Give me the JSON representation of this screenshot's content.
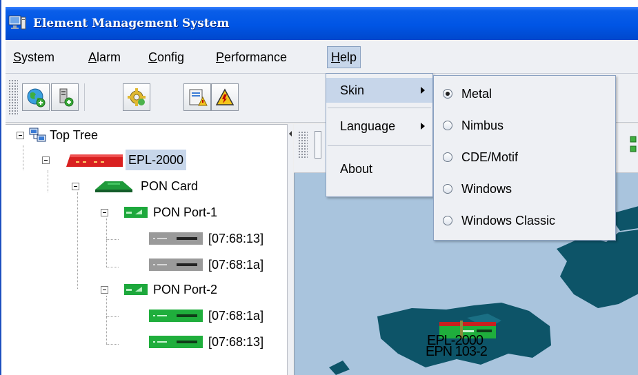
{
  "window": {
    "title": "Element Management System",
    "title_icon": "monitor-app-icon"
  },
  "menubar": {
    "items": [
      {
        "id": "system",
        "label": "System",
        "mnemonic": "S",
        "rest": "ystem"
      },
      {
        "id": "alarm",
        "label": "Alarm",
        "mnemonic": "A",
        "rest": "larm"
      },
      {
        "id": "config",
        "label": "Config",
        "mnemonic": "C",
        "rest": "onfig"
      },
      {
        "id": "performance",
        "label": "Performance",
        "mnemonic": "P",
        "rest": "erformance"
      },
      {
        "id": "help",
        "label": "Help",
        "mnemonic": "H",
        "rest": "elp",
        "open": true
      }
    ]
  },
  "toolbar": {
    "buttons": [
      {
        "icon": "globe-add-icon"
      },
      {
        "icon": "server-add-icon"
      },
      {
        "icon": "gear-icon"
      },
      {
        "icon": "alarm-report-icon"
      },
      {
        "icon": "warning-triangle-icon"
      }
    ]
  },
  "tree": {
    "root": {
      "label": "Top Tree",
      "icon": "network-tree-icon"
    },
    "device": {
      "label": "EPL-2000",
      "icon": "red-device-icon",
      "selected": true
    },
    "card": {
      "label": "PON Card",
      "icon": "green-card-icon"
    },
    "ports": [
      {
        "label": "PON Port-1",
        "icon": "port-icon",
        "onus": [
          {
            "label": "[07:68:13]",
            "state": "offline"
          },
          {
            "label": "[07:68:1a]",
            "state": "offline"
          }
        ]
      },
      {
        "label": "PON Port-2",
        "icon": "port-icon",
        "onus": [
          {
            "label": "[07:68:1a]",
            "state": "online"
          },
          {
            "label": "[07:68:13]",
            "state": "online"
          }
        ]
      }
    ]
  },
  "help_menu": {
    "items": [
      {
        "label": "Skin",
        "has_submenu": true,
        "active": true
      },
      {
        "label": "Language",
        "has_submenu": true
      },
      {
        "label": "About",
        "has_submenu": false
      }
    ]
  },
  "skin_menu": {
    "selected": "Metal",
    "options": [
      "Metal",
      "Nimbus",
      "CDE/Motif",
      "Windows",
      "Windows Classic"
    ]
  },
  "map": {
    "device_label_1": "EPL-2000",
    "device_label_2": "EPN 103-2",
    "colors": {
      "water": "#a9c4dd",
      "land": "#0d5468"
    }
  },
  "colors": {
    "title_bar": "#0055e5",
    "selection": "#c7d6ea",
    "menu_border": "#8aa1c1"
  }
}
